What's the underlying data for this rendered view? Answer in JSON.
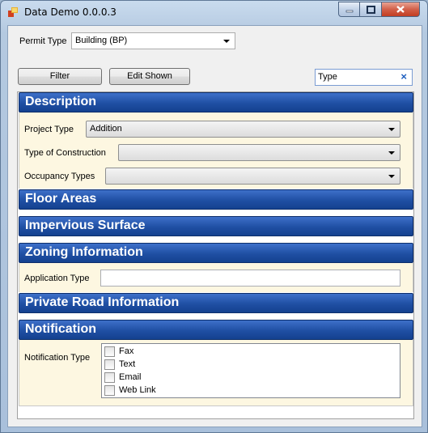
{
  "window": {
    "title": "Data Demo 0.0.0.3"
  },
  "permit": {
    "label": "Permit Type",
    "value": "Building (BP)"
  },
  "toolbar": {
    "filter_label": "Filter",
    "edit_shown_label": "Edit Shown"
  },
  "search": {
    "value": "Type",
    "clear_glyph": "×"
  },
  "sections": {
    "description": {
      "title": "Description",
      "project_type_label": "Project Type",
      "project_type_value": "Addition",
      "construction_label": "Type of Construction",
      "construction_value": "",
      "occupancy_label": "Occupancy Types",
      "occupancy_value": ""
    },
    "floor_areas": {
      "title": "Floor Areas"
    },
    "impervious": {
      "title": "Impervious Surface"
    },
    "zoning": {
      "title": "Zoning Information",
      "application_type_label": "Application Type",
      "application_type_value": ""
    },
    "private_road": {
      "title": "Private Road Information"
    },
    "notification": {
      "title": "Notification",
      "type_label": "Notification Type",
      "options": [
        "Fax",
        "Text",
        "Email",
        "Web Link"
      ]
    }
  },
  "icons": {
    "app": "app-icon",
    "minimize": "minimize-icon",
    "maximize": "maximize-icon",
    "close": "close-icon"
  }
}
